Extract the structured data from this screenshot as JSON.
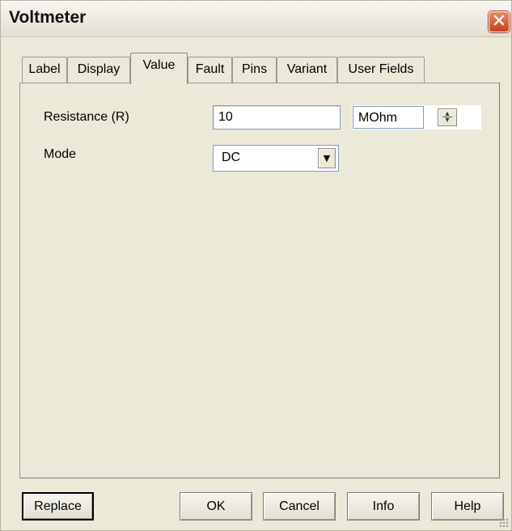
{
  "window": {
    "title": "Voltmeter",
    "close_glyph": "✕"
  },
  "tabs": [
    {
      "label": "Label"
    },
    {
      "label": "Display"
    },
    {
      "label": "Value",
      "active": true
    },
    {
      "label": "Fault"
    },
    {
      "label": "Pins"
    },
    {
      "label": "Variant"
    },
    {
      "label": "User Fields"
    }
  ],
  "value_tab": {
    "resistance": {
      "label": "Resistance (R)",
      "value": "10",
      "unit": "MOhm"
    },
    "mode": {
      "label": "Mode",
      "selected": "DC"
    }
  },
  "buttons": {
    "replace": "Replace",
    "ok": "OK",
    "cancel": "Cancel",
    "info": "Info",
    "help": "Help"
  },
  "icons": {
    "close": "close-icon",
    "dropdown": "chevron-down-icon",
    "spinner": "spin-updown-icon"
  },
  "colors": {
    "dialog_bg": "#ece9d8",
    "close_button": "#c6401c",
    "field_border": "#7f9db9"
  }
}
